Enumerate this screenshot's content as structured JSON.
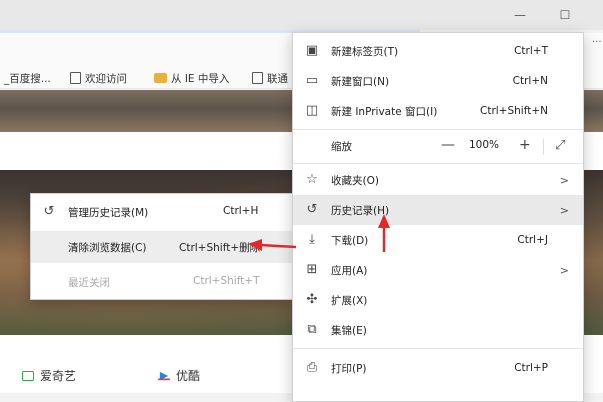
{
  "window": {
    "minimize_icon": "minimize-icon",
    "maximize_icon": "maximize-icon",
    "more_label": "···"
  },
  "favorites": [
    {
      "label": "_百度搜...",
      "icon": "none"
    },
    {
      "label": "欢迎访问",
      "icon": "page-icon"
    },
    {
      "label": "从 IE 中导入",
      "icon": "folder-icon"
    },
    {
      "label": "联通",
      "icon": "page-icon"
    }
  ],
  "sites": [
    {
      "label": "爱奇艺",
      "color": "#3aa33f"
    },
    {
      "label": "优酷",
      "color": "#1e88e5"
    }
  ],
  "menu": {
    "items": [
      {
        "label": "新建标签页(T)",
        "shortcut": "Ctrl+T",
        "icon": "new-tab-icon"
      },
      {
        "label": "新建窗口(N)",
        "shortcut": "Ctrl+N",
        "icon": "new-window-icon"
      },
      {
        "label": "新建 InPrivate 窗口(I)",
        "shortcut": "Ctrl+Shift+N",
        "icon": "inprivate-icon"
      },
      {
        "label": "缩放",
        "zoom_value": "100%",
        "zoom_minus": "—",
        "zoom_plus": "+"
      },
      {
        "label": "收藏夹(O)",
        "arrow": ">",
        "icon": "favorites-icon"
      },
      {
        "label": "历史记录(H)",
        "arrow": ">",
        "icon": "history-icon"
      },
      {
        "label": "下载(D)",
        "shortcut": "Ctrl+J",
        "icon": "download-icon"
      },
      {
        "label": "应用(A)",
        "arrow": ">",
        "icon": "apps-icon"
      },
      {
        "label": "扩展(X)",
        "icon": "extensions-icon"
      },
      {
        "label": "集锦(E)",
        "icon": "collections-icon"
      },
      {
        "label": "打印(P)",
        "shortcut": "Ctrl+P",
        "icon": "print-icon"
      }
    ]
  },
  "history_submenu": {
    "items": [
      {
        "label": "管理历史记录(M)",
        "shortcut": "Ctrl+H",
        "icon": "history-icon",
        "disabled": false
      },
      {
        "label": "清除浏览数据(C)",
        "shortcut": "Ctrl+Shift+删除",
        "disabled": false
      },
      {
        "label": "最近关闭",
        "shortcut": "Ctrl+Shift+T",
        "disabled": true
      }
    ]
  },
  "colors": {
    "annotation_arrow": "#e02a2a",
    "highlight": "#e9e9e9"
  }
}
